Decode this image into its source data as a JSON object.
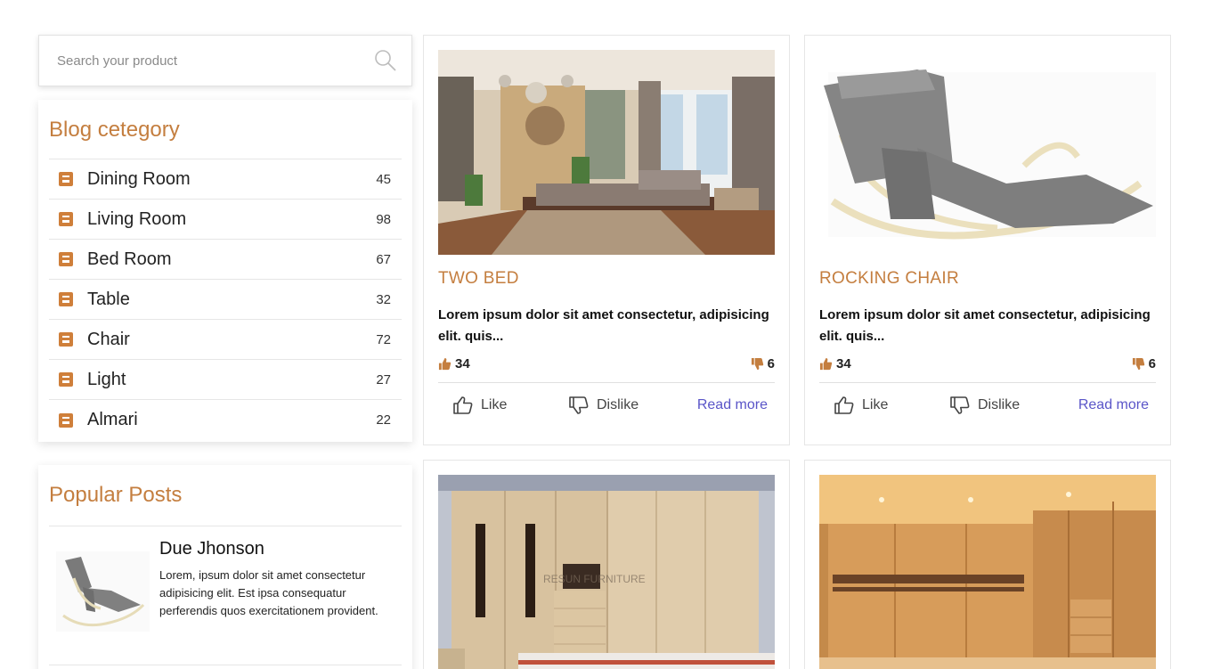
{
  "search": {
    "placeholder": "Search your product"
  },
  "blog": {
    "title": "Blog cetegory",
    "items": [
      {
        "label": "Dining Room",
        "count": "45"
      },
      {
        "label": "Living Room",
        "count": "98"
      },
      {
        "label": "Bed Room",
        "count": "67"
      },
      {
        "label": "Table",
        "count": "32"
      },
      {
        "label": "Chair",
        "count": "72"
      },
      {
        "label": "Light",
        "count": "27"
      },
      {
        "label": "Almari",
        "count": "22"
      }
    ]
  },
  "popular": {
    "title": "Popular Posts",
    "post": {
      "name": "Due Jhonson",
      "text": "Lorem, ipsum dolor sit amet consectetur adipisicing elit. Est ipsa consequatur perferendis quos exercitationem provident."
    }
  },
  "cards": [
    {
      "title": "TWO BED",
      "desc": "Lorem ipsum dolor sit amet consectetur, adipisicing elit. quis...",
      "likes": "34",
      "dislikes": "6",
      "like_label": "Like",
      "dislike_label": "Dislike",
      "read_more": "Read more"
    },
    {
      "title": "ROCKING CHAIR",
      "desc": "Lorem ipsum dolor sit amet consectetur, adipisicing elit. quis...",
      "likes": "34",
      "dislikes": "6",
      "like_label": "Like",
      "dislike_label": "Dislike",
      "read_more": "Read more"
    }
  ],
  "image_watermark": "RESUN FURNITURE",
  "colors": {
    "accent": "#c47e3f",
    "link": "#5a55c8",
    "icon": "#cf7f3a"
  }
}
